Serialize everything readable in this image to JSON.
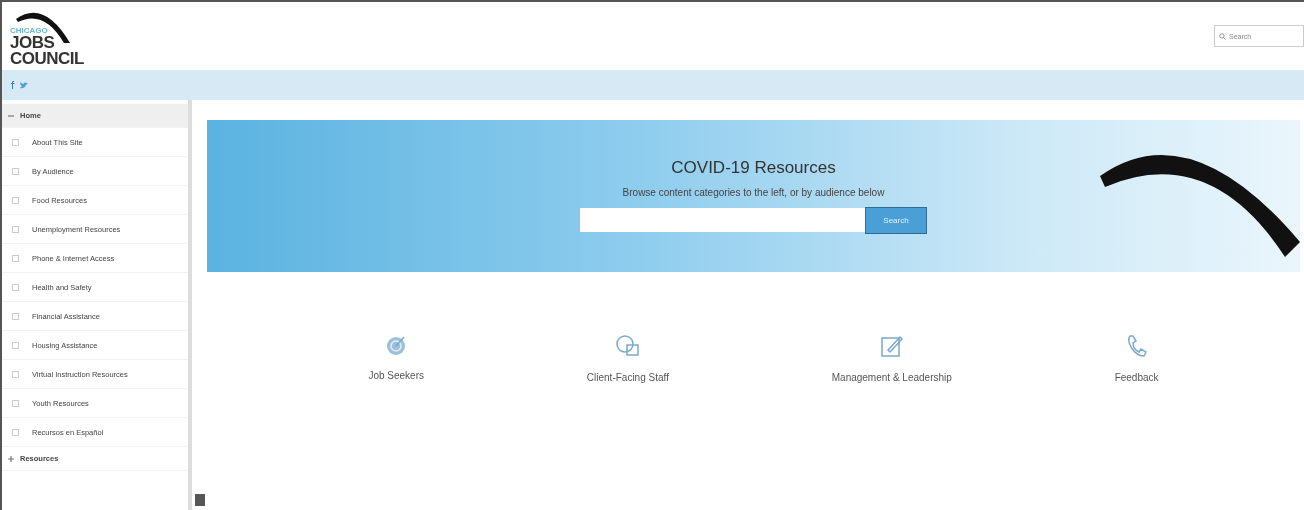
{
  "header": {
    "logo": {
      "small": "CHICAGO",
      "line1": "JOBS",
      "line2": "COUNCIL"
    },
    "search": {
      "placeholder": "Search"
    }
  },
  "sidebar": {
    "items": [
      {
        "label": "Home",
        "expanded": true,
        "selected": true,
        "children": [
          {
            "label": "About This Site"
          },
          {
            "label": "By Audience"
          },
          {
            "label": "Food Resources"
          },
          {
            "label": "Unemployment Resources"
          },
          {
            "label": "Phone & Internet Access"
          },
          {
            "label": "Health and Safety"
          },
          {
            "label": "Financial Assistance"
          },
          {
            "label": "Housing Assistance"
          },
          {
            "label": "Virtual Instruction Resources"
          },
          {
            "label": "Youth Resources"
          },
          {
            "label": "Recursos en Español"
          }
        ]
      },
      {
        "label": "Resources",
        "expanded": false,
        "selected": false
      }
    ]
  },
  "banner": {
    "title": "COVID-19 Resources",
    "subtitle": "Browse content categories to the left, or by audience below",
    "button": "Search"
  },
  "audiences": [
    {
      "kind": "target",
      "label": "Job Seekers"
    },
    {
      "kind": "chat",
      "label": "Client-Facing Staff"
    },
    {
      "kind": "edit",
      "label": "Management & Leadership"
    },
    {
      "kind": "phone",
      "label": "Feedback"
    }
  ]
}
